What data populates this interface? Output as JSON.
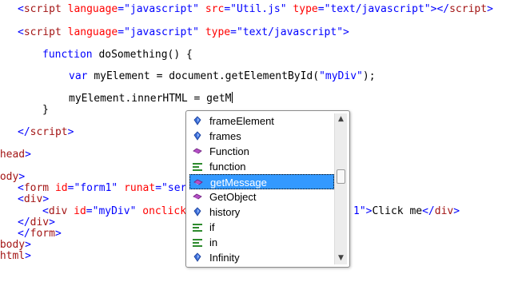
{
  "code": {
    "line1": {
      "open": "<",
      "tag": "script",
      "a1": "language",
      "v1": "\"javascript\"",
      "a2": "src",
      "v2": "\"Util.js\"",
      "a3": "type",
      "v3": "\"text/javascript\"",
      "close": "></",
      "tag2": "script"
    },
    "line2": {
      "open": "<",
      "tag": "script",
      "a1": "language",
      "v1": "\"javascript\"",
      "a2": "type",
      "v2": "\"text/javascript\"",
      "close": ">"
    },
    "line3": {
      "kw": "function",
      "rest": "doSomething() {"
    },
    "line4": {
      "kw": "var",
      "rest1": "myElement = document.getElementById(",
      "str": "\"myDiv\"",
      "rest2": ");"
    },
    "line5": {
      "text": "myElement.innerHTML = getM"
    },
    "line6": {
      "text": "}"
    },
    "line7": {
      "open": "</",
      "tag": "script",
      "close": ">"
    },
    "line8": {
      "tag": "/head",
      "close": ">"
    },
    "line9": {
      "tag": "body",
      "close": ">"
    },
    "line10": {
      "open": "<",
      "tag": "form",
      "a1": "id",
      "v1": "\"form1\"",
      "a2": "runat",
      "v2": "\"ser"
    },
    "line11": {
      "open": "<",
      "tag": "div",
      "close": ">"
    },
    "line12": {
      "open": "<",
      "tag": "div",
      "a1": "id",
      "v1": "\"myDiv\"",
      "a2": "onclick"
    },
    "line12b": {
      "frag": "1\"",
      "close1": ">",
      "text": "Click me",
      "open2": "</",
      "tag2": "div",
      "close2": ">"
    },
    "line13": {
      "open": "</",
      "tag": "div",
      "close": ">"
    },
    "line14": {
      "open": "</",
      "tag": "form",
      "close": ">"
    },
    "line15": {
      "tag": "/body",
      "close": ">"
    },
    "line16": {
      "tag": "/html",
      "close": ">"
    }
  },
  "completion": {
    "items": [
      {
        "label": "frameElement",
        "icon": "property-icon"
      },
      {
        "label": "frames",
        "icon": "property-icon"
      },
      {
        "label": "Function",
        "icon": "method-icon"
      },
      {
        "label": "function",
        "icon": "keyword-icon"
      },
      {
        "label": "getMessage",
        "icon": "method-icon",
        "selected": true
      },
      {
        "label": "GetObject",
        "icon": "method-icon"
      },
      {
        "label": "history",
        "icon": "property-icon"
      },
      {
        "label": "if",
        "icon": "keyword-icon"
      },
      {
        "label": "in",
        "icon": "keyword-icon"
      },
      {
        "label": "Infinity",
        "icon": "property-icon"
      }
    ],
    "scroll_up": "▲",
    "scroll_down": "▼"
  },
  "colors": {
    "tag": "#a31515",
    "attribute": "#ff0000",
    "string": "#0000ff",
    "keyword": "#0000ff",
    "selection": "#3399ff"
  }
}
